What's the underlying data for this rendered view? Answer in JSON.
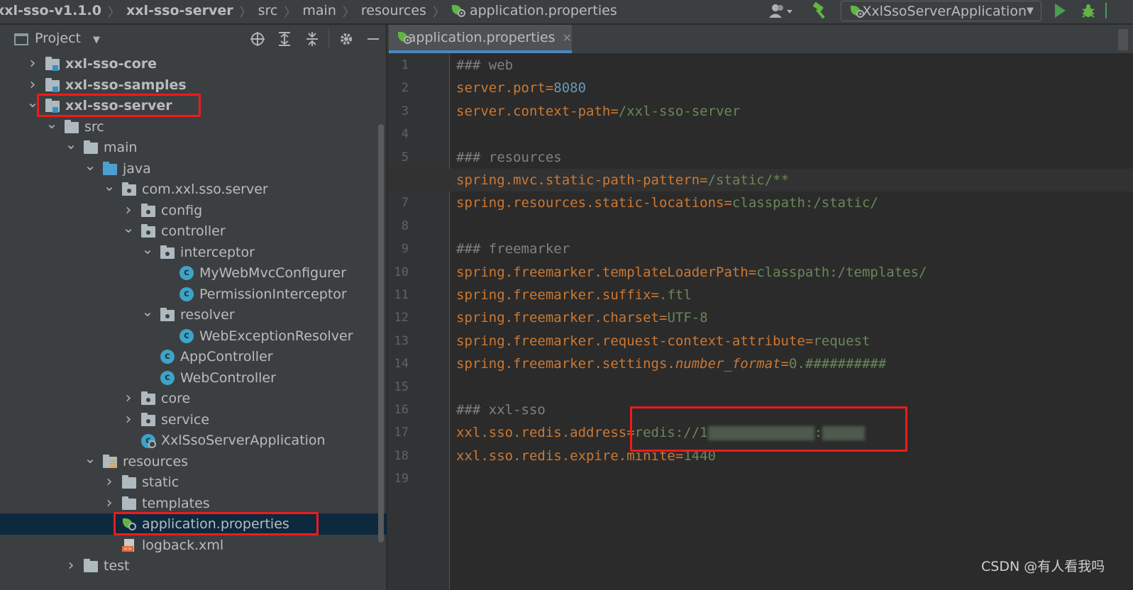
{
  "breadcrumb": {
    "items": [
      "xxl-sso-v1.1.0",
      "xxl-sso-server",
      "src",
      "main",
      "resources",
      "application.properties"
    ]
  },
  "toolbar": {
    "run_config": "XxlSsoServerApplication",
    "user_icon": "user-icon",
    "build_icon": "hammer-icon",
    "run_icon": "run-icon",
    "debug_icon": "debug-icon"
  },
  "project_panel": {
    "title": "Project",
    "tree": [
      {
        "label": "xxl-sso-core",
        "depth": 0,
        "expanded": false,
        "icon": "module-folder-icon",
        "bold": true
      },
      {
        "label": "xxl-sso-samples",
        "depth": 0,
        "expanded": false,
        "icon": "module-folder-icon",
        "bold": true
      },
      {
        "label": "xxl-sso-server",
        "depth": 0,
        "expanded": true,
        "icon": "module-folder-icon",
        "bold": true,
        "highlighted": true
      },
      {
        "label": "src",
        "depth": 1,
        "expanded": true,
        "icon": "folder-icon"
      },
      {
        "label": "main",
        "depth": 2,
        "expanded": true,
        "icon": "folder-icon"
      },
      {
        "label": "java",
        "depth": 3,
        "expanded": true,
        "icon": "source-root-icon"
      },
      {
        "label": "com.xxl.sso.server",
        "depth": 4,
        "expanded": true,
        "icon": "package-icon"
      },
      {
        "label": "config",
        "depth": 5,
        "expanded": false,
        "icon": "package-icon"
      },
      {
        "label": "controller",
        "depth": 5,
        "expanded": true,
        "icon": "package-icon"
      },
      {
        "label": "interceptor",
        "depth": 6,
        "expanded": true,
        "icon": "package-icon"
      },
      {
        "label": "MyWebMvcConfigurer",
        "depth": 7,
        "icon": "class-icon"
      },
      {
        "label": "PermissionInterceptor",
        "depth": 7,
        "icon": "class-icon"
      },
      {
        "label": "resolver",
        "depth": 6,
        "expanded": true,
        "icon": "package-icon"
      },
      {
        "label": "WebExceptionResolver",
        "depth": 7,
        "icon": "class-icon"
      },
      {
        "label": "AppController",
        "depth": 6,
        "icon": "class-icon"
      },
      {
        "label": "WebController",
        "depth": 6,
        "icon": "class-icon"
      },
      {
        "label": "core",
        "depth": 5,
        "expanded": false,
        "icon": "package-icon"
      },
      {
        "label": "service",
        "depth": 5,
        "expanded": false,
        "icon": "package-icon"
      },
      {
        "label": "XxlSsoServerApplication",
        "depth": 5,
        "icon": "spring-app-icon"
      },
      {
        "label": "resources",
        "depth": 3,
        "expanded": true,
        "icon": "resources-folder-icon"
      },
      {
        "label": "static",
        "depth": 4,
        "expanded": false,
        "icon": "folder-icon"
      },
      {
        "label": "templates",
        "depth": 4,
        "expanded": false,
        "icon": "folder-icon"
      },
      {
        "label": "application.properties",
        "depth": 4,
        "icon": "spring-properties-icon",
        "selected": true,
        "highlighted": true
      },
      {
        "label": "logback.xml",
        "depth": 4,
        "icon": "xml-file-icon"
      },
      {
        "label": "test",
        "depth": 2,
        "expanded": false,
        "icon": "folder-icon"
      }
    ]
  },
  "editor": {
    "tab_label": "application.properties",
    "current_line": 6,
    "lines": [
      [
        {
          "t": "### web",
          "c": "comment"
        }
      ],
      [
        {
          "t": "server.port",
          "c": "key"
        },
        {
          "t": "=",
          "c": "eq"
        },
        {
          "t": "8080",
          "c": "num"
        }
      ],
      [
        {
          "t": "server.context-path",
          "c": "key"
        },
        {
          "t": "=",
          "c": "eq"
        },
        {
          "t": "/xxl-sso-server",
          "c": "val"
        }
      ],
      [],
      [
        {
          "t": "### resources",
          "c": "comment"
        }
      ],
      [
        {
          "t": "spring.mvc.static-path-pattern",
          "c": "key"
        },
        {
          "t": "=",
          "c": "eq"
        },
        {
          "t": "/static/**",
          "c": "val"
        }
      ],
      [
        {
          "t": "spring.resources.static-locations",
          "c": "key"
        },
        {
          "t": "=",
          "c": "eq"
        },
        {
          "t": "classpath:/static/",
          "c": "val"
        }
      ],
      [],
      [
        {
          "t": "### freemarker",
          "c": "comment"
        }
      ],
      [
        {
          "t": "spring.freemarker.templateLoaderPath",
          "c": "key"
        },
        {
          "t": "=",
          "c": "eq"
        },
        {
          "t": "classpath:/templates/",
          "c": "val"
        }
      ],
      [
        {
          "t": "spring.freemarker.suffix",
          "c": "key"
        },
        {
          "t": "=",
          "c": "eq"
        },
        {
          "t": ".ftl",
          "c": "val"
        }
      ],
      [
        {
          "t": "spring.freemarker.charset",
          "c": "key"
        },
        {
          "t": "=",
          "c": "eq"
        },
        {
          "t": "UTF-8",
          "c": "val"
        }
      ],
      [
        {
          "t": "spring.freemarker.request-context-attribute",
          "c": "key"
        },
        {
          "t": "=",
          "c": "eq"
        },
        {
          "t": "request",
          "c": "val"
        }
      ],
      [
        {
          "t": "spring.freemarker.settings.",
          "c": "key"
        },
        {
          "t": "number_format",
          "c": "italic"
        },
        {
          "t": "=",
          "c": "eq"
        },
        {
          "t": "0.##########",
          "c": "val"
        }
      ],
      [],
      [
        {
          "t": "### xxl-sso",
          "c": "comment"
        }
      ],
      [
        {
          "t": "xxl.sso.redis.address",
          "c": "key"
        },
        {
          "t": "=",
          "c": "eq"
        },
        {
          "t": "redis://1",
          "c": "val"
        },
        {
          "redacted": true,
          "w": 150
        },
        {
          "t": ":",
          "c": "val"
        },
        {
          "redacted": true,
          "w": 60
        }
      ],
      [
        {
          "t": "xxl.sso.redis.expire.minite",
          "c": "key"
        },
        {
          "t": "=",
          "c": "eq"
        },
        {
          "t": "1440",
          "c": "val"
        }
      ],
      []
    ]
  },
  "watermark": "CSDN @有人看我吗",
  "colors": {
    "highlight_box": "#ef1b1b",
    "key": "#cc7832",
    "value": "#6a8759",
    "number": "#6897bb",
    "comment": "#808080",
    "selection": "#0d293e"
  }
}
